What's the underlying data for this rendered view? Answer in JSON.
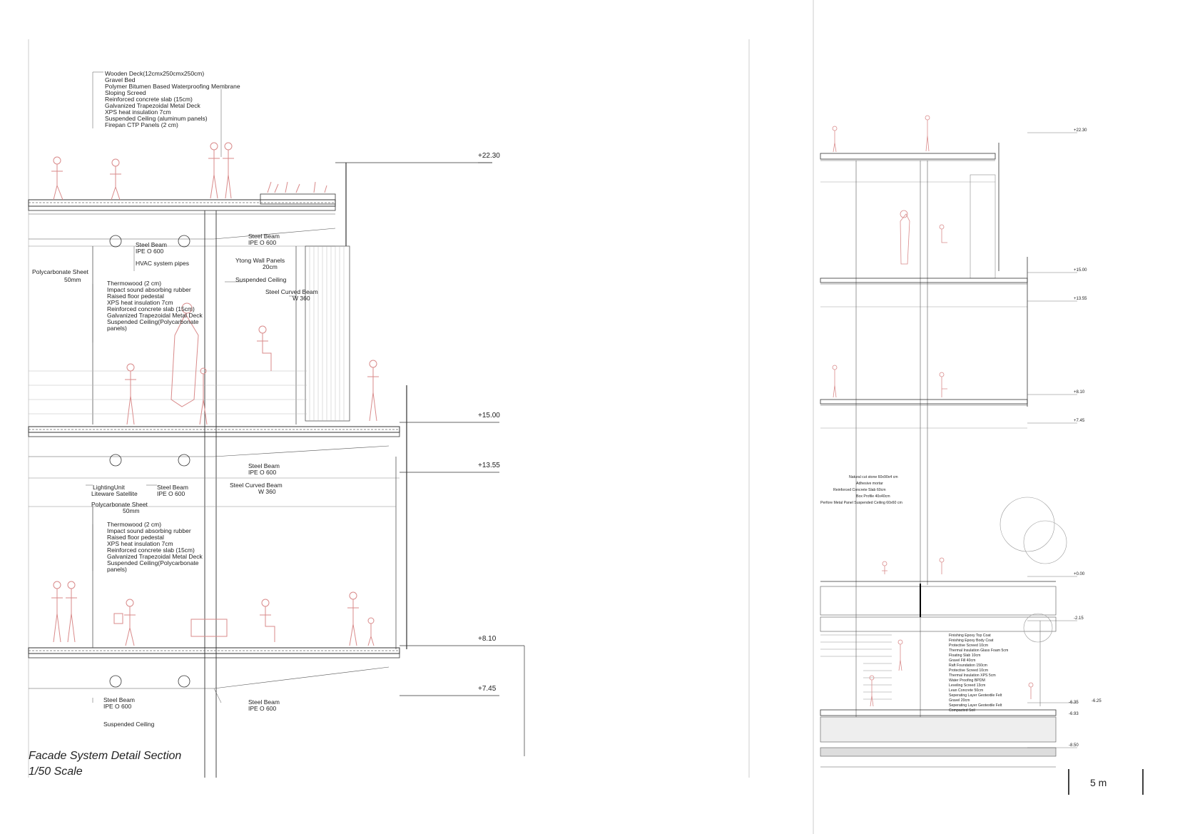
{
  "left": {
    "title": "Facade System Detail Section",
    "scale": "1/50  Scale",
    "roof_layers": [
      "Wooden Deck(12cmx250cmx250cm)",
      "Gravel Bed",
      "Polymer Bitumen Based Waterproofing Membrane",
      "Sloping Screed",
      "Reinforced concrete slab (15cm)",
      "Galvanized Trapezoidal Metal Deck",
      "XPS heat insulation 7cm",
      "Suspended Ceiling (aluminum panels)",
      "Firepan CTP Panels (2 cm)"
    ],
    "floor_layers_1": [
      "Thermowood (2 cm)",
      "Impact sound absorbing rubber",
      "Raised floor pedestal",
      "XPS heat insulation 7cm",
      "Reinforced concrete slab (15cm)",
      "Galvanized Trapezoidal Metal Deck",
      "Suspended Ceiling(Polycarbonate",
      "panels)"
    ],
    "floor_layers_2": [
      "Thermowood (2 cm)",
      "Impact sound absorbing rubber",
      "Raised floor pedestal",
      "XPS heat insulation 7cm",
      "Reinforced concrete slab (15cm)",
      "Galvanized Trapezoidal Metal Deck",
      "Suspended Ceiling(Polycarbonate",
      "panels)"
    ],
    "labels": {
      "steel_beam_a1": "Steel Beam",
      "steel_beam_a2": "IPE O 600",
      "steel_beam_b1": "Steel Beam",
      "steel_beam_b2": "IPE O 600",
      "hvac": "HVAC system pipes",
      "ytong1": "Ytong Wall Panels",
      "ytong2": "20cm",
      "poly1a": "Polycarbonate Sheet",
      "poly1b": "50mm",
      "susp1": "Suspended Ceiling",
      "curved1a": "Steel Curved Beam",
      "curved1b": "W 360",
      "steel_beam_c1": "Steel Beam",
      "steel_beam_c2": "IPE O 600",
      "curved2a": "Steel Curved Beam",
      "curved2b": "W 360",
      "light1": "LightingUnit",
      "light2": "Liteware Satellite",
      "steel_beam_d1": "Steel Beam",
      "steel_beam_d2": "IPE O 600",
      "poly2a": "Polycarbonate Sheet",
      "poly2b": "50mm",
      "steel_beam_e1": "Steel Beam",
      "steel_beam_e2": "IPE O 600",
      "steel_beam_f1": "Steel Beam",
      "steel_beam_f2": "IPE O 600",
      "susp2": "Suspended Ceiling"
    },
    "elevations": [
      "+22.30",
      "+15.00",
      "+13.55",
      "+8.10",
      "+7.45"
    ]
  },
  "right": {
    "elevations": [
      "+22.30",
      "+15.00",
      "+13.55",
      "+8.10",
      "+7.45",
      "+0.00",
      "-2.15",
      "-6.35",
      "-6.93",
      "-6.25",
      "-8.50"
    ],
    "stone_layers": [
      "Natural cut stone 60x90x4 cm",
      "Adhesive mortar",
      "Reinforced Concrete Slab 60cm",
      "Box Profile 40x40cm",
      "Perfore Metal Panel Suspended Ceiling 60x60 cm"
    ],
    "foundation_layers": [
      "Finishing Epoxy Top Coat",
      "Finishing Epoxy Body Coat",
      "Protective Screed 10cm",
      "Thermal Insulation Glass Foam 5cm",
      "Floating Slab 10cm",
      "Gravel Fill 40cm",
      "Raft Foundation 150cm",
      "Protective Screed 10cm",
      "Thermal Insulation XPS 5cm",
      "Water Proofing BPDM",
      "Leveling Screed 13cm",
      "Lean Concrete 50cm",
      "Seperating Layer Geotextile Felt",
      "Gravel 20cm",
      "Seperating Layer Geotextile Felt",
      "Compacted Soil"
    ],
    "scale_bar": "5 m"
  },
  "colors": {
    "figures": "#d98a8a",
    "lines": "#333333",
    "light": "#999999"
  }
}
